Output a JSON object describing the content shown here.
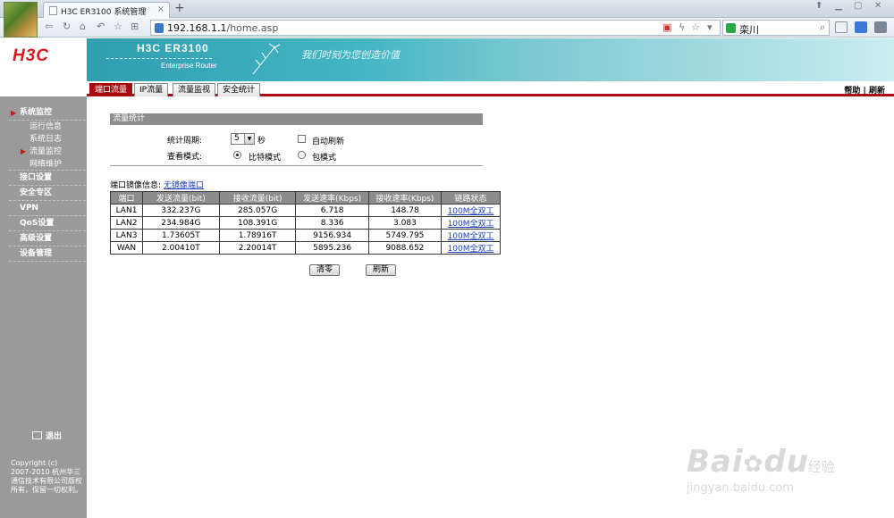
{
  "browser": {
    "tab_title": "H3C ER3100 系统管理",
    "new_tab": "+",
    "url_host": "192.168.1.1",
    "url_path": "/home.asp",
    "search_query": "栾川"
  },
  "header": {
    "logo": "H3C",
    "model": "H3C ER3100",
    "subtitle": "Enterprise Router",
    "slogan": "我们时刻为您创造价值"
  },
  "module_tabs": [
    "端口流量",
    "IP流量",
    "流量监视",
    "安全统计"
  ],
  "help_links": {
    "help": "帮助",
    "sep": "|",
    "refresh": "刷新"
  },
  "sidebar": {
    "menu": [
      {
        "label": "系统监控",
        "arrow": "▶"
      },
      {
        "label": "接口设置"
      },
      {
        "label": "安全专区"
      },
      {
        "label": "VPN"
      },
      {
        "label": "QoS设置"
      },
      {
        "label": "高级设置"
      },
      {
        "label": "设备管理"
      }
    ],
    "submenu": [
      {
        "label": "运行信息"
      },
      {
        "label": "系统日志"
      },
      {
        "label": "流量监控",
        "arrow": "▶"
      },
      {
        "label": "网络维护"
      }
    ],
    "logout": "退出",
    "copyright": "Copyright (c)\n2007-2010 杭州华三通信技术有限公司版权所有，保留一切权利。"
  },
  "content": {
    "section_title": "流量统计",
    "period_label": "统计周期:",
    "period_value": "5",
    "period_unit": "秒",
    "auto_refresh_label": "自动刷新",
    "view_mode_label": "查看模式:",
    "mode_bit": "比特模式",
    "mode_packet": "包模式",
    "mirror_label": "端口镜像信息:",
    "mirror_value": "无镜像端口",
    "table": {
      "headers": [
        "端口",
        "发送流量(bit)",
        "接收流量(bit)",
        "发送速率(Kbps)",
        "接收速率(Kbps)",
        "链路状态"
      ],
      "rows": [
        [
          "LAN1",
          "332.237G",
          "285.057G",
          "6.718",
          "148.78",
          "100M全双工"
        ],
        [
          "LAN2",
          "234.984G",
          "108.391G",
          "8.336",
          "3.083",
          "100M全双工"
        ],
        [
          "LAN3",
          "1.73605T",
          "1.78916T",
          "9156.934",
          "5749.795",
          "100M全双工"
        ],
        [
          "WAN",
          "2.00410T",
          "2.20014T",
          "5895.236",
          "9088.652",
          "100M全双工"
        ]
      ]
    },
    "clear_button": "清零",
    "refresh_button": "刷新"
  },
  "watermark": {
    "brand": "Bai",
    "brand2": "du",
    "jingyan": "经验",
    "url": "jingyan.baidu.com"
  }
}
